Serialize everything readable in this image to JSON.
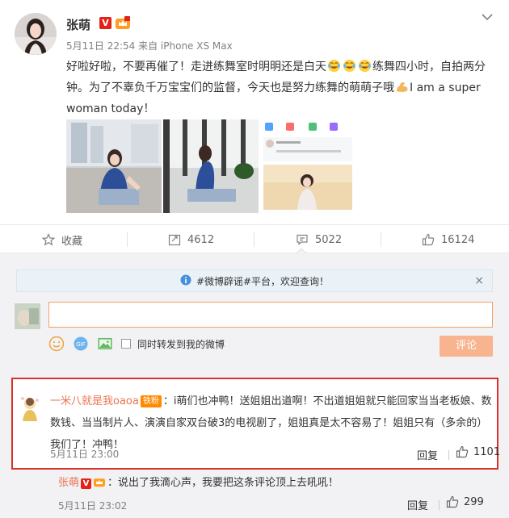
{
  "post": {
    "author": "张萌",
    "verified_badge": "V",
    "meta": "5月11日 22:54 来自 iPhone XS Max",
    "content_part1": "好啦好啦，不要再催了！走进练舞室时明明还是白天",
    "content_part2": "练舞四小时，自拍两分钟。为了不辜负千万宝宝们的监督，今天也是努力练舞的萌萌子哦",
    "content_part3": "I am a super woman today！",
    "icons": {
      "menu": "chevron-down-icon",
      "emoji": "crying-laughing-emoji-icon",
      "strong": "flexed-biceps-emoji-icon"
    }
  },
  "actions": {
    "favorite_label": "收藏",
    "repost_count": "4612",
    "comment_count": "5022",
    "like_count": "16124"
  },
  "comment_area": {
    "notice_text": "#微博辟谣#平台，欢迎查询！",
    "close_symbol": "×",
    "repost_checkbox_label": "同时转发到我的微博",
    "submit_label": "评论",
    "accent_color": "#eb7350"
  },
  "top_comment": {
    "author": "一米八就是我oaoa",
    "fan_badge": "铁粉",
    "text": "：i萌们也冲鸭！送姐姐出道啊！不出道姐姐就只能回家当当老板娘、数数钱、当当制片人、演演自家双台破3的电视剧了，姐姐真是太不容易了！姐姐只有（多余的）我们了！冲鸭！",
    "time": "5月11日 23:00",
    "reply_label": "回复",
    "like_count": "1101"
  },
  "sub_reply": {
    "author": "张萌",
    "verified_badge": "V",
    "text": "：说出了我滴心声，我要把这条评论顶上去吼吼！",
    "time": "5月11日 23:02",
    "reply_label": "回复",
    "like_count": "299"
  }
}
